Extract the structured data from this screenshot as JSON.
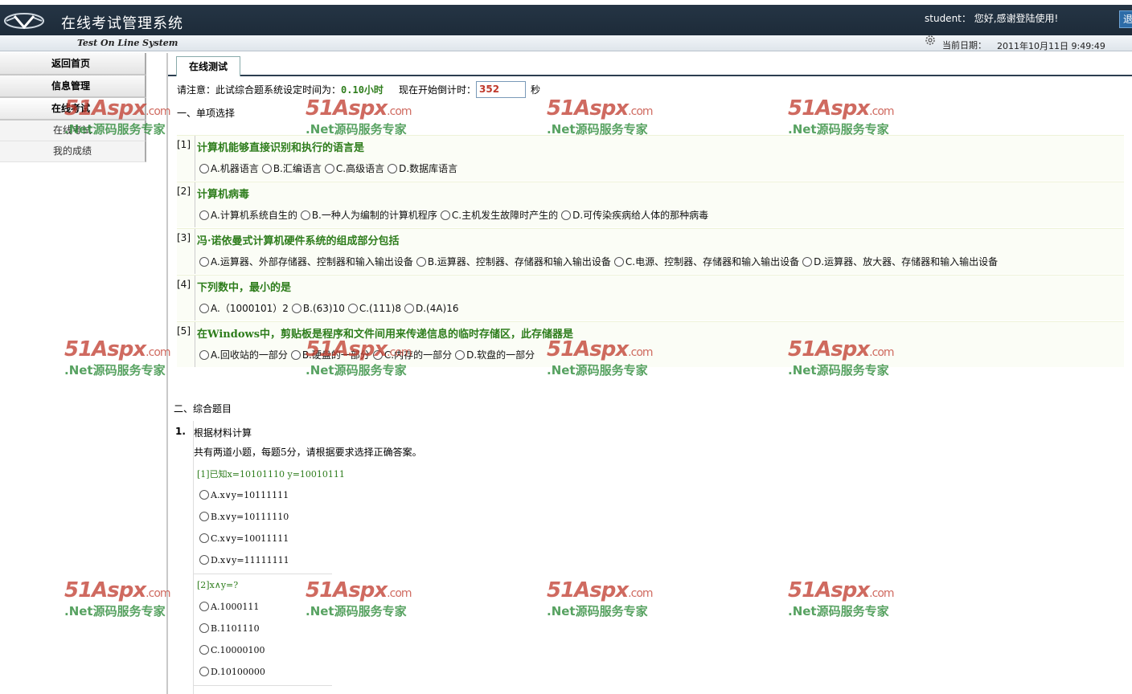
{
  "header": {
    "title": "在线考试管理系统",
    "subtitle": "Test On Line System",
    "greeting": "student： 您好,感谢登陆使用!",
    "exit_label": "退",
    "date_label": "当前日期：",
    "date_value": "2011年10月11日 9:49:49"
  },
  "sidebar": {
    "items": [
      {
        "label": "返回首页"
      },
      {
        "label": "信息管理"
      },
      {
        "label": "在线考试"
      }
    ],
    "sub_items": [
      {
        "label": "在线考试"
      },
      {
        "label": "我的成绩"
      }
    ]
  },
  "tab": {
    "label": "在线测试"
  },
  "exam": {
    "notice_prefix": "请注意：此试综合题系统设定时间为：",
    "hours": "0.10小时",
    "countdown_label": "现在开始倒计时：",
    "countdown_value": "352",
    "countdown_unit": "秒",
    "section1": "一、单项选择",
    "questions": [
      {
        "num": "[1]",
        "title": "计算机能够直接识别和执行的语言是",
        "options": [
          "A.机器语言",
          "B.汇编语言",
          "C.高级语言",
          "D.数据库语言"
        ]
      },
      {
        "num": "[2]",
        "title": "计算机病毒",
        "options": [
          "A.计算机系统自生的",
          "B.一种人为编制的计算机程序",
          "C.主机发生故障时产生的",
          "D.可传染疾病给人体的那种病毒"
        ]
      },
      {
        "num": "[3]",
        "title": "冯·诺依曼式计算机硬件系统的组成部分包括",
        "options": [
          "A.运算器、外部存储器、控制器和输入输出设备",
          "B.运算器、控制器、存储器和输入输出设备",
          "C.电源、控制器、存储器和输入输出设备",
          "D.运算器、放大器、存储器和输入输出设备"
        ]
      },
      {
        "num": "[4]",
        "title": "下列数中，最小的是",
        "options": [
          "A.（1000101）2",
          "B.(63)10",
          "C.(111)8",
          "D.(4A)16"
        ]
      },
      {
        "num": "[5]",
        "title": "在Windows中，剪贴板是程序和文件间用来传递信息的临时存储区，此存储器是",
        "options": [
          "A.回收站的一部分",
          "B.硬盘的一部分",
          "C.内存的一部分",
          "D.软盘的一部分"
        ]
      }
    ],
    "section2": "二、综合题目",
    "comprehensive": {
      "num": "1.",
      "title": "根据材料计算",
      "desc": "共有两道小题，每题5分，请根据要求选择正确答案。",
      "sub_questions": [
        {
          "title": "[1]已知x=10101110 y=10010111",
          "options": [
            "A.x∨y=10111111",
            "B.x∨y=10111110",
            "C.x∨y=10011111",
            "D.x∨y=11111111"
          ]
        },
        {
          "title": "[2]x∧y=?",
          "options": [
            "A.1000111",
            "B.1101110",
            "C.10000100",
            "D.10100000"
          ]
        }
      ]
    }
  },
  "watermark": {
    "brand": "51Aspx",
    "domain": ".com",
    "tagline": ".Net源码服务专家"
  },
  "colors": {
    "header_bg": "#1d2b39",
    "question_title": "#2e7d1c",
    "countdown": "#c0392b",
    "watermark_red": "#c0392b",
    "watermark_green": "#2e8b3a"
  }
}
